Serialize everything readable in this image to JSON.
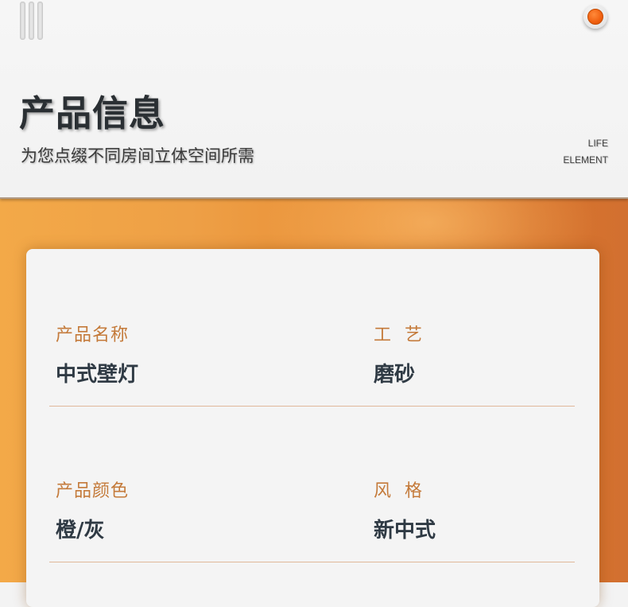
{
  "header": {
    "title": "产品信息",
    "subtitle": "为您点缀不同房间立体空间所需",
    "tagline_line1": "LIFE",
    "tagline_line2": "ELEMENT"
  },
  "icons": {
    "menu": "menu-icon",
    "indicator": "orange-dot-icon"
  },
  "colors": {
    "accent": "#e8882f",
    "label": "#c47a3a",
    "value": "#2f3a44"
  },
  "product": {
    "rows": [
      {
        "left_label": "产品名称",
        "left_value": "中式壁灯",
        "right_label": "工  艺",
        "right_value": "磨砂"
      },
      {
        "left_label": "产品颜色",
        "left_value": "橙/灰",
        "right_label": "风  格",
        "right_value": "新中式"
      }
    ]
  }
}
